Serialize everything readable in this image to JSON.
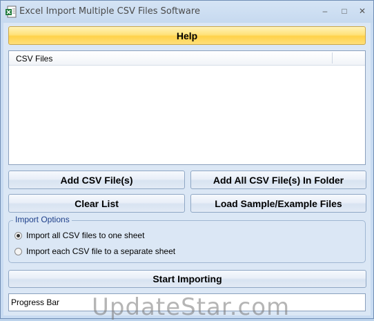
{
  "window": {
    "title": "Excel Import Multiple CSV Files Software",
    "minimize_glyph": "–",
    "maximize_glyph": "□",
    "close_glyph": "✕",
    "icon": "excel-app-icon"
  },
  "help_button": {
    "label": "Help"
  },
  "file_list": {
    "column_header": "CSV Files",
    "items": []
  },
  "buttons": {
    "add_files": "Add CSV File(s)",
    "add_folder": "Add All CSV File(s) In Folder",
    "clear_list": "Clear List",
    "load_sample": "Load Sample/Example Files",
    "start": "Start Importing"
  },
  "import_options": {
    "legend": "Import Options",
    "options": [
      {
        "label": "Import all CSV files to one sheet",
        "selected": true
      },
      {
        "label": "Import each CSV file to a separate sheet",
        "selected": false
      }
    ]
  },
  "progress_bar": {
    "label": "Progress Bar",
    "progress": 0
  },
  "watermark": "UpdateStar.com",
  "colors": {
    "help_button": "#ffd24a",
    "window_frame": "#c9dcf2",
    "group_legend": "#1e3f8a"
  }
}
